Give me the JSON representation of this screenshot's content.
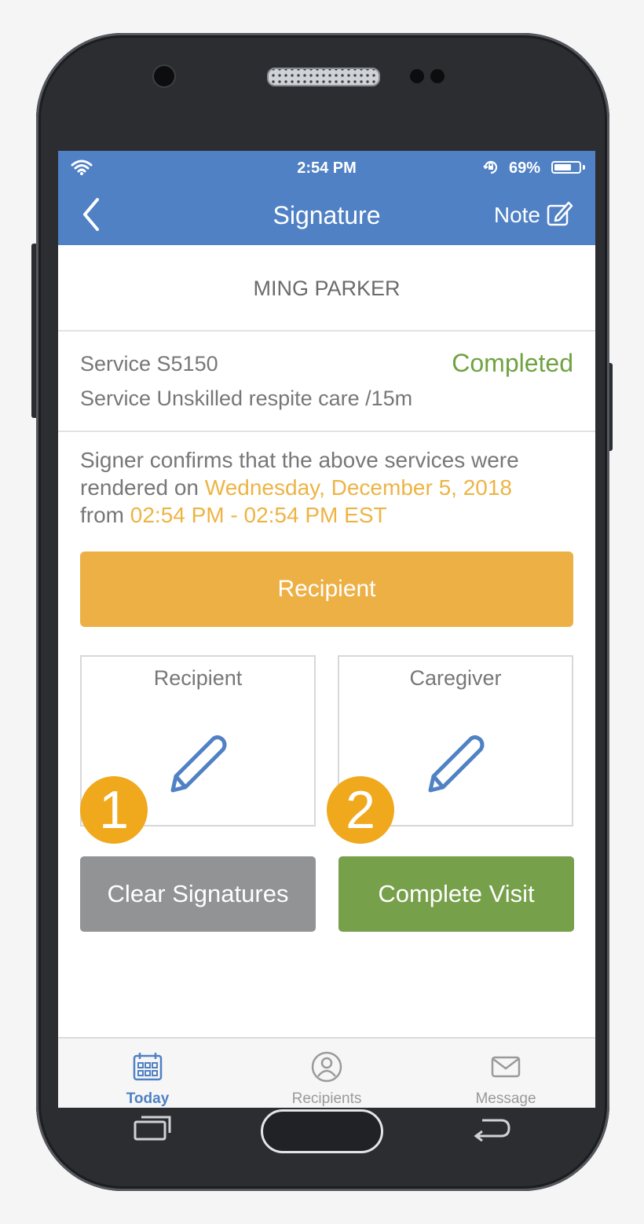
{
  "status_bar": {
    "time": "2:54 PM",
    "battery_percent_label": "69%",
    "battery_level": 0.69,
    "icons": [
      "wifi-icon",
      "rotation-lock-icon",
      "battery-icon"
    ]
  },
  "nav": {
    "title": "Signature",
    "note_label": "Note",
    "back_icon": "chevron-left-icon",
    "note_icon": "edit-note-icon"
  },
  "recipient_name": "MING PARKER",
  "service": {
    "code": "Service S5150",
    "description": "Service Unskilled respite care /15m",
    "status": "Completed"
  },
  "confirmation": {
    "line1": "Signer confirms that the above services were",
    "rendered_on": "rendered on ",
    "date": "Wednesday, December 5, 2018",
    "from": "from ",
    "time_range": "02:54 PM - 02:54 PM EST"
  },
  "signer_button_label": "Recipient",
  "signature_boxes": [
    {
      "label": "Recipient",
      "icon": "pencil-icon"
    },
    {
      "label": "Caregiver",
      "icon": "pencil-icon"
    }
  ],
  "callouts": [
    "1",
    "2"
  ],
  "actions": {
    "clear_label": "Clear Signatures",
    "complete_label": "Complete Visit"
  },
  "tabs": [
    {
      "label": "Today",
      "icon": "calendar-icon",
      "active": true
    },
    {
      "label": "Recipients",
      "icon": "user-icon",
      "active": false
    },
    {
      "label": "Message",
      "icon": "envelope-icon",
      "active": false
    }
  ],
  "colors": {
    "header": "#4f81c4",
    "accent_yellow": "#edb045",
    "completed_green": "#6fa241",
    "clear_gray": "#929395",
    "complete_green": "#77a04a",
    "callout_orange": "#f0a81c"
  }
}
